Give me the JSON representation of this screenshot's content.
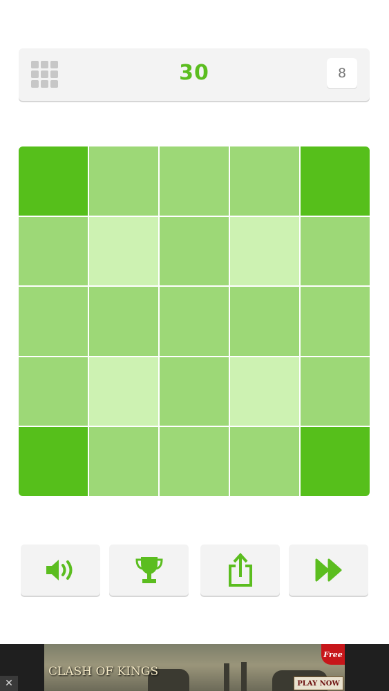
{
  "header": {
    "score": "30",
    "level": "8"
  },
  "colors": {
    "accent": "#5bbd1f",
    "dark": "#56bf1b",
    "mid": "#9dd877",
    "light": "#cdf2b2"
  },
  "grid": {
    "rows": [
      [
        "dark",
        "mid",
        "mid",
        "mid",
        "dark"
      ],
      [
        "mid",
        "light",
        "mid",
        "light",
        "mid"
      ],
      [
        "mid",
        "mid",
        "mid",
        "mid",
        "mid"
      ],
      [
        "mid",
        "light",
        "mid",
        "light",
        "mid"
      ],
      [
        "dark",
        "mid",
        "mid",
        "mid",
        "dark"
      ]
    ]
  },
  "controls": {
    "sound": "speaker-icon",
    "leaderboard": "trophy-icon",
    "share": "share-icon",
    "skip": "fast-forward-icon"
  },
  "ad": {
    "title": "CLASH OF KINGS",
    "cta": "PLAY NOW",
    "badge": "Free",
    "close": "✕"
  }
}
